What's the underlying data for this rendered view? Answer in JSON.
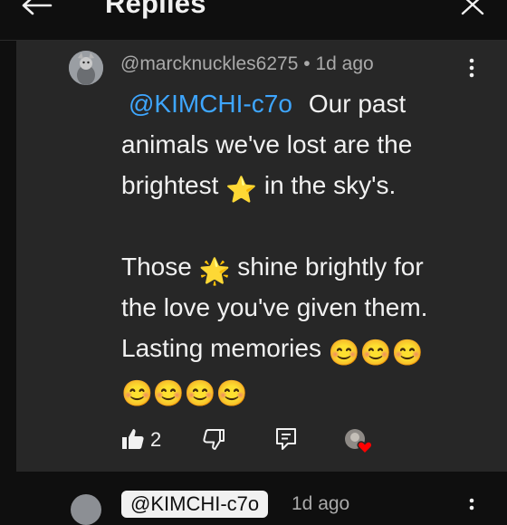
{
  "header": {
    "title": "Replies",
    "back_icon": "arrow-left-icon",
    "close_icon": "close-icon"
  },
  "comment": {
    "author": "@marcknuckles6275",
    "separator": "•",
    "time": "1d ago",
    "mention": "@KIMCHI-c7o",
    "lines": [
      "Our past",
      "animals we've lost are the",
      "brightest",
      "in the sky's.",
      "",
      "Those",
      "shine brightly for",
      "the love you've given them.",
      "Lasting memories"
    ],
    "emoji": {
      "star": "⭐",
      "glowing_star": "🌟",
      "smile": "😊"
    },
    "likes": "2",
    "icons": [
      "more-vert-icon",
      "thumbs-up-icon",
      "thumbs-down-icon",
      "reply-icon",
      "creator-heart-icon"
    ],
    "colors": {
      "mention": "#3ea6ff",
      "card_bg": "#272727",
      "page_bg": "#0f0f0f",
      "heart": "#ff0000"
    }
  },
  "next_reply": {
    "mention_chip": "@KIMCHI-c7o",
    "time": "1d ago"
  }
}
